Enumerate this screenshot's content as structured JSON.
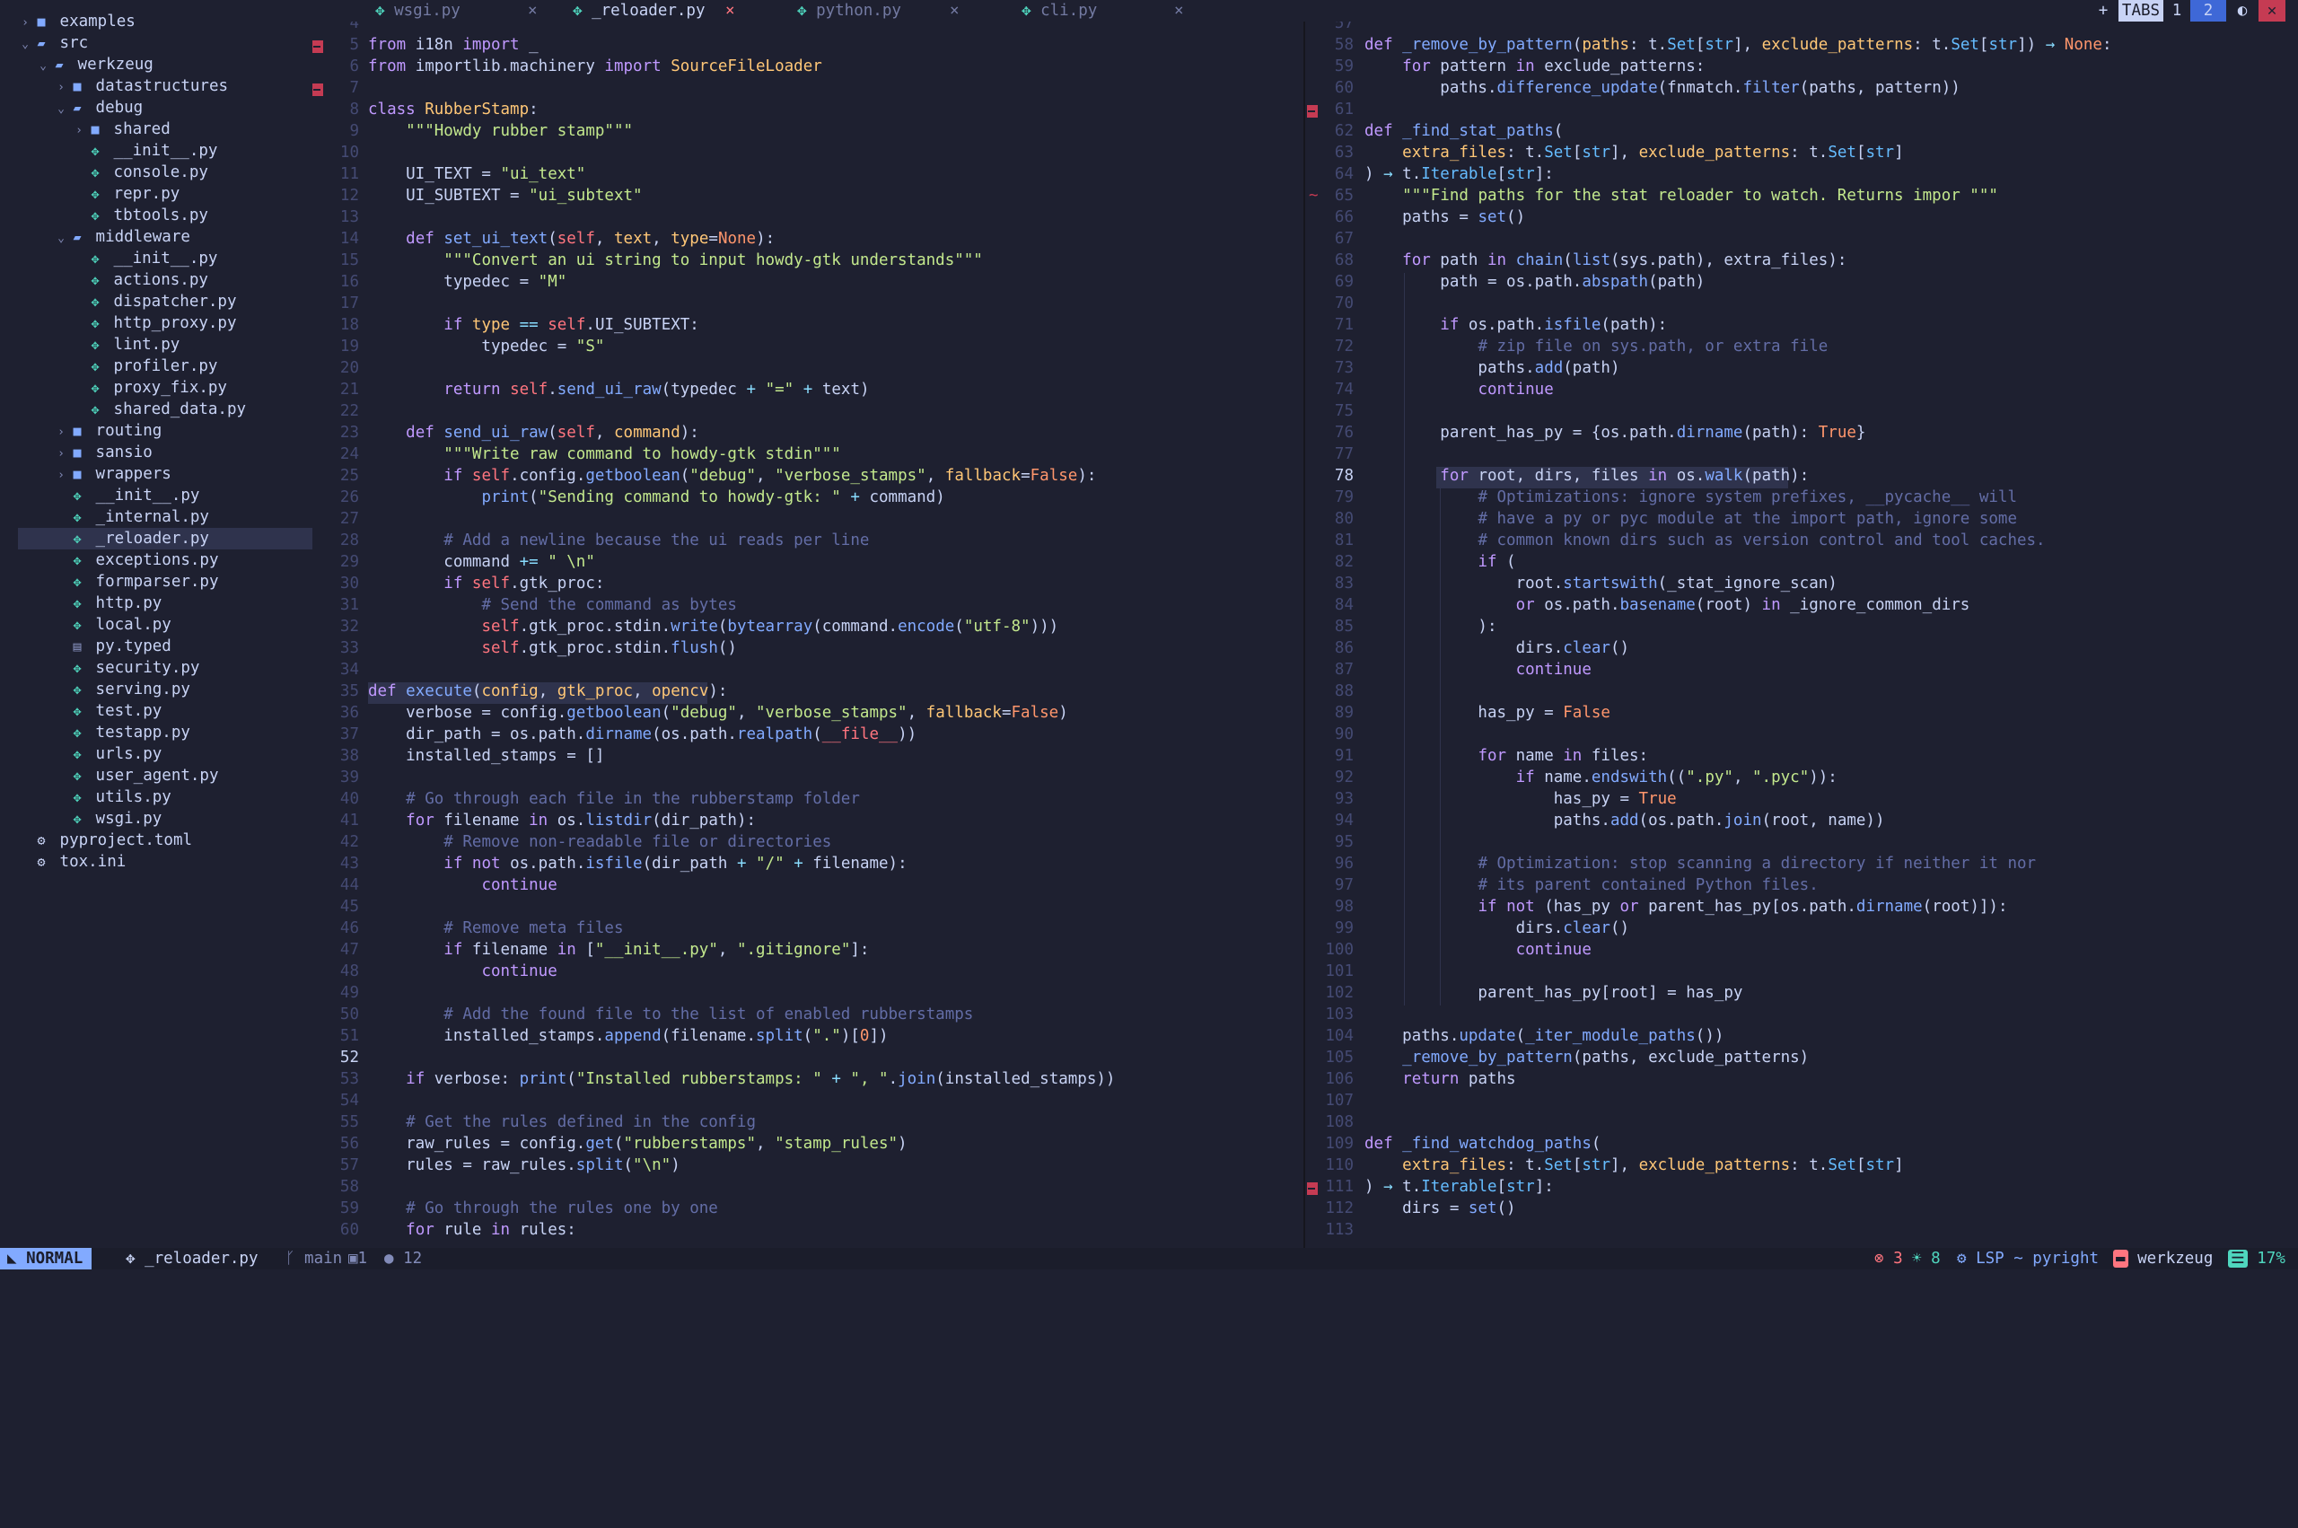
{
  "sidebar": {
    "rows": [
      {
        "label": "examples",
        "kind": "folder",
        "open": false,
        "depth": 0,
        "selected": false
      },
      {
        "label": "src",
        "kind": "folder",
        "open": true,
        "depth": 0,
        "selected": false
      },
      {
        "label": "werkzeug",
        "kind": "folder",
        "open": true,
        "depth": 1,
        "selected": false
      },
      {
        "label": "datastructures",
        "kind": "folder",
        "open": false,
        "depth": 2,
        "selected": false
      },
      {
        "label": "debug",
        "kind": "folder",
        "open": true,
        "depth": 2,
        "selected": false
      },
      {
        "label": "shared",
        "kind": "folder",
        "open": false,
        "depth": 3,
        "selected": false
      },
      {
        "label": "__init__.py",
        "kind": "py",
        "depth": 3,
        "selected": false
      },
      {
        "label": "console.py",
        "kind": "py",
        "depth": 3,
        "selected": false
      },
      {
        "label": "repr.py",
        "kind": "py",
        "depth": 3,
        "selected": false
      },
      {
        "label": "tbtools.py",
        "kind": "py",
        "depth": 3,
        "selected": false
      },
      {
        "label": "middleware",
        "kind": "folder",
        "open": true,
        "depth": 2,
        "selected": false
      },
      {
        "label": "__init__.py",
        "kind": "py",
        "depth": 3,
        "selected": false
      },
      {
        "label": "actions.py",
        "kind": "py",
        "depth": 3,
        "selected": false
      },
      {
        "label": "dispatcher.py",
        "kind": "py",
        "depth": 3,
        "selected": false
      },
      {
        "label": "http_proxy.py",
        "kind": "py",
        "depth": 3,
        "selected": false
      },
      {
        "label": "lint.py",
        "kind": "py",
        "depth": 3,
        "selected": false
      },
      {
        "label": "profiler.py",
        "kind": "py",
        "depth": 3,
        "selected": false
      },
      {
        "label": "proxy_fix.py",
        "kind": "py",
        "depth": 3,
        "selected": false
      },
      {
        "label": "shared_data.py",
        "kind": "py",
        "depth": 3,
        "selected": false
      },
      {
        "label": "routing",
        "kind": "folder",
        "open": false,
        "depth": 2,
        "selected": false
      },
      {
        "label": "sansio",
        "kind": "folder",
        "open": false,
        "depth": 2,
        "selected": false
      },
      {
        "label": "wrappers",
        "kind": "folder",
        "open": false,
        "depth": 2,
        "selected": false
      },
      {
        "label": "__init__.py",
        "kind": "py",
        "depth": 2,
        "selected": false
      },
      {
        "label": "_internal.py",
        "kind": "py",
        "depth": 2,
        "selected": false
      },
      {
        "label": "_reloader.py",
        "kind": "py",
        "depth": 2,
        "selected": true
      },
      {
        "label": "exceptions.py",
        "kind": "py",
        "depth": 2,
        "selected": false
      },
      {
        "label": "formparser.py",
        "kind": "py",
        "depth": 2,
        "selected": false
      },
      {
        "label": "http.py",
        "kind": "py",
        "depth": 2,
        "selected": false
      },
      {
        "label": "local.py",
        "kind": "py",
        "depth": 2,
        "selected": false
      },
      {
        "label": "py.typed",
        "kind": "file",
        "depth": 2,
        "selected": false
      },
      {
        "label": "security.py",
        "kind": "py",
        "depth": 2,
        "selected": false
      },
      {
        "label": "serving.py",
        "kind": "py",
        "depth": 2,
        "selected": false
      },
      {
        "label": "test.py",
        "kind": "py",
        "depth": 2,
        "selected": false
      },
      {
        "label": "testapp.py",
        "kind": "py",
        "depth": 2,
        "selected": false
      },
      {
        "label": "urls.py",
        "kind": "py",
        "depth": 2,
        "selected": false
      },
      {
        "label": "user_agent.py",
        "kind": "py",
        "depth": 2,
        "selected": false
      },
      {
        "label": "utils.py",
        "kind": "py",
        "depth": 2,
        "selected": false
      },
      {
        "label": "wsgi.py",
        "kind": "py",
        "depth": 2,
        "selected": false
      },
      {
        "label": "pyproject.toml",
        "kind": "gear",
        "depth": 0,
        "selected": false
      },
      {
        "label": "tox.ini",
        "kind": "gear",
        "depth": 0,
        "selected": false
      }
    ]
  },
  "tabs": [
    {
      "label": "wsgi.py",
      "active": false
    },
    {
      "label": "_reloader.py",
      "active": true
    },
    {
      "label": "python.py",
      "active": false
    },
    {
      "label": "cli.py",
      "active": false
    }
  ],
  "tabs_right": {
    "plus": "+",
    "label": "TABS",
    "tab1": "1",
    "tab2": "2"
  },
  "left_editor": {
    "start": 4,
    "current": 52,
    "signs": [
      5,
      7
    ],
    "lines": [
      "",
      "§kfrom§ i18n §kimport§ _",
      "§kfrom§ importlib.machinery §kimport§ §pSourceFileLoader§",
      "",
      "§kclass§ §pRubberStamp§:",
      "    §s\"\"\"Howdy rubber stamp\"\"\"§",
      "",
      "    UI_TEXT = §s\"ui_text\"§",
      "    UI_SUBTEXT = §s\"ui_subtext\"§",
      "",
      "    §kdef§ §fset_ui_text§(§rself§, §ptext§, §ptype§=§nNone§):",
      "        §s\"\"\"Convert an ui string to input howdy-gtk understands\"\"\"§",
      "        typedec = §s\"M\"§",
      "",
      "        §kif§ §ptype§ §o==§ §rself§.UI_SUBTEXT:",
      "            typedec = §s\"S\"§",
      "",
      "        §kreturn§ §rself§.§fsend_ui_raw§(typedec §o+§ §s\"=\"§ §o+§ text)",
      "",
      "    §kdef§ §fsend_ui_raw§(§rself§, §pcommand§):",
      "        §s\"\"\"Write raw command to howdy-gtk stdin\"\"\"§",
      "        §kif§ §rself§.config.§fgetboolean§(§s\"debug\"§, §s\"verbose_stamps\"§, §pfallback§=§nFalse§):",
      "            §fprint§(§s\"Sending command to howdy-gtk: \"§ §o+§ command)",
      "",
      "        §c# Add a newline because the ui reads per line§",
      "        command §o+=§ §s\" \\n\"§",
      "        §kif§ §rself§.gtk_proc:",
      "            §c# Send the command as bytes§",
      "            §rself§.gtk_proc.stdin.§fwrite§(§fbytearray§(command.§fencode§(§s\"utf-8\"§)))",
      "            §rself§.gtk_proc.stdin.§fflush§()",
      "",
      "§kdef§ §fexecute§(§pconfig§, §pgtk_proc§, §popencv§):",
      "    verbose = config.§fgetboolean§(§s\"debug\"§, §s\"verbose_stamps\"§, §pfallback§=§nFalse§)",
      "    dir_path = os.path.§fdirname§(os.path.§frealpath§(§r__file__§))",
      "    installed_stamps = []",
      "",
      "    §c# Go through each file in the rubberstamp folder§",
      "    §kfor§ filename §kin§ os.§flistdir§(dir_path):",
      "        §c# Remove non-readable file or directories§",
      "        §kif§ §knot§ os.path.§fisfile§(dir_path §o+§ §s\"/\"§ §o+§ filename):",
      "            §kcontinue§",
      "",
      "        §c# Remove meta files§",
      "        §kif§ filename §kin§ [§s\"__init__.py\"§, §s\".gitignore\"§]:",
      "            §kcontinue§",
      "",
      "        §c# Add the found file to the list of enabled rubberstamps§",
      "        installed_stamps.§fappend§(filename.§fsplit§(§s\".\"§)[§n0§])",
      "",
      "    §kif§ verbose: §fprint§(§s\"Installed rubberstamps: \"§ §o+§ §s\", \"§.§fjoin§(installed_stamps))",
      "",
      "    §c# Get the rules defined in the config§",
      "    raw_rules = config.§fget§(§s\"rubberstamps\"§, §s\"stamp_rules\"§)",
      "    rules = raw_rules.§fsplit§(§s\"\\n\"§)",
      "",
      "    §c# Go through the rules one by one§",
      "    §kfor§ rule §kin§ rules:"
    ]
  },
  "right_editor": {
    "start": 57,
    "current": 78,
    "signs": [
      61,
      111
    ],
    "tilde": [
      65
    ],
    "lines": [
      "",
      "§kdef§ §f_remove_by_pattern§(§ppaths§: t.§tSet§[§tstr§], §pexclude_patterns§: t.§tSet§[§tstr§]) §o→§ §nNone§:",
      "    §kfor§ pattern §kin§ exclude_patterns:",
      "        paths.§fdifference_update§(fnmatch.§ffilter§(paths, pattern))",
      "",
      "§kdef§ §f_find_stat_paths§(",
      "    §pextra_files§: t.§tSet§[§tstr§], §pexclude_patterns§: t.§tSet§[§tstr§]",
      ") §o→§ t.§tIterable§[§tstr§]:",
      "    §s\"\"\"Find paths for the stat reloader to watch. Returns impor \"\"\"§",
      "    paths = §fset§()",
      "",
      "    §kfor§ path §kin§ §fchain§(§flist§(sys.path), extra_files):",
      "        path = os.path.§fabspath§(path)",
      "",
      "        §kif§ os.path.§fisfile§(path):",
      "            §c# zip file on sys.path, or extra file§",
      "            paths.§fadd§(path)",
      "            §kcontinue§",
      "",
      "        parent_has_py = {os.path.§fdirname§(path): §nTrue§}",
      "",
      "        §kfor§ root, dirs, files §kin§ os.§fwalk§(path):",
      "            §c# Optimizations: ignore system prefixes, __pycache__ will§",
      "            §c# have a py or pyc module at the import path, ignore some§",
      "            §c# common known dirs such as version control and tool caches.§",
      "            §kif§ (",
      "                root.§fstartswith§(_stat_ignore_scan)",
      "                §kor§ os.path.§fbasename§(root) §kin§ _ignore_common_dirs",
      "            ):",
      "                dirs.§fclear§()",
      "                §kcontinue§",
      "",
      "            has_py = §nFalse§",
      "",
      "            §kfor§ name §kin§ files:",
      "                §kif§ name.§fendswith§((§s\".py\"§, §s\".pyc\"§)):",
      "                    has_py = §nTrue§",
      "                    paths.§fadd§(os.path.§fjoin§(root, name))",
      "",
      "            §c# Optimization: stop scanning a directory if neither it nor§",
      "            §c# its parent contained Python files.§",
      "            §kif§ §knot§ (has_py §kor§ parent_has_py[os.path.§fdirname§(root)]):",
      "                dirs.§fclear§()",
      "                §kcontinue§",
      "",
      "            parent_has_py[root] = has_py",
      "",
      "    paths.§fupdate§(§f_iter_module_paths§())",
      "    §f_remove_by_pattern§(paths, exclude_patterns)",
      "    §kreturn§ paths",
      "",
      "",
      "§kdef§ §f_find_watchdog_paths§(",
      "    §pextra_files§: t.§tSet§[§tstr§], §pexclude_patterns§: t.§tSet§[§tstr§]",
      ") §o→§ t.§tIterable§[§tstr§]:",
      "    dirs = §fset§()",
      ""
    ]
  },
  "status": {
    "mode": "NORMAL",
    "file": "_reloader.py",
    "branch": "main",
    "changes": "1",
    "count": "12",
    "errors": "3",
    "hints": "8",
    "lsp": "LSP ~ pyright",
    "project": "werkzeug",
    "percent": "17%"
  },
  "colors": {
    "bg": "#1e2030",
    "accent": "#82aaff",
    "keyword": "#c099ff",
    "function": "#82aaff",
    "string": "#c3e88d",
    "comment": "#636da6",
    "python_icon": "#4fd6be",
    "error": "#c53b53"
  }
}
